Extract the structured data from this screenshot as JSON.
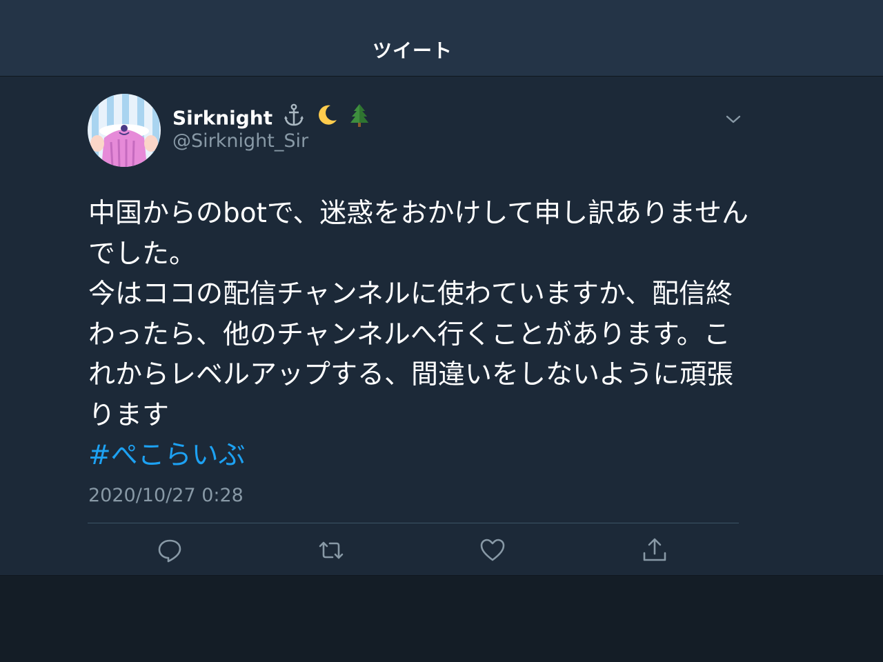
{
  "status_fragment": ")",
  "header": {
    "title": "ツイート"
  },
  "tweet": {
    "display_name": "Sirknight",
    "name_emojis": [
      "anchor-emoji",
      "crescent-moon-emoji",
      "evergreen-tree-emoji"
    ],
    "handle": "@Sirknight_Sir",
    "body_lines": [
      "中国からのbotで、迷惑をおかけして申し訳ありませんでした。",
      "今はココの配信チャンネルに使わていますか、配信終わったら、他のチャンネルへ行くことがあります。これからレベルアップする、間違いをしないように頑張ります"
    ],
    "hashtag": "#ぺこらいぶ",
    "timestamp": "2020/10/27 0:28"
  },
  "actions": [
    "reply-icon",
    "retweet-icon",
    "like-icon",
    "share-icon"
  ],
  "colors": {
    "background": "#15202b",
    "header": "#243447",
    "panel": "#1c2938",
    "text_secondary": "#8899a6",
    "link": "#1da1f2"
  }
}
